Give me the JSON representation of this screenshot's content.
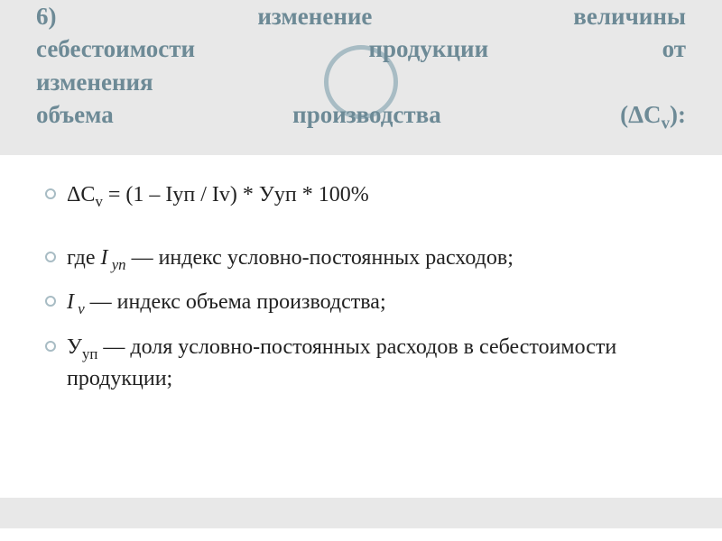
{
  "header": {
    "line1_left": "6)",
    "line1_mid": "изменение",
    "line1_right": "величины",
    "line2_left": "себестоимости",
    "line2_mid": "продукции",
    "line2_right": "от",
    "line3": "изменения",
    "line4_left": "объема",
    "line4_mid": "производства",
    "line4_right_prefix": "(ΔС",
    "line4_right_sub": "v",
    "line4_right_suffix": "):"
  },
  "bullets": {
    "b1_prefix": "ΔС",
    "b1_sub": "v",
    "b1_rest": " =  (1 – Iуп / Iv) * Ууп * 100%",
    "b2_prefix": "где ",
    "b2_var": "I",
    "b2_var_sub": " уп",
    "b2_rest": "  — индекс условно-постоянных расходов;",
    "b3_var": "I",
    "b3_var_sub": " v",
    "b3_rest": " — индекс объема производства;",
    "b4_prefix": "У",
    "b4_sub": "уп",
    "b4_rest": "  — доля условно-постоянных расходов в себестоимости продукции;"
  }
}
